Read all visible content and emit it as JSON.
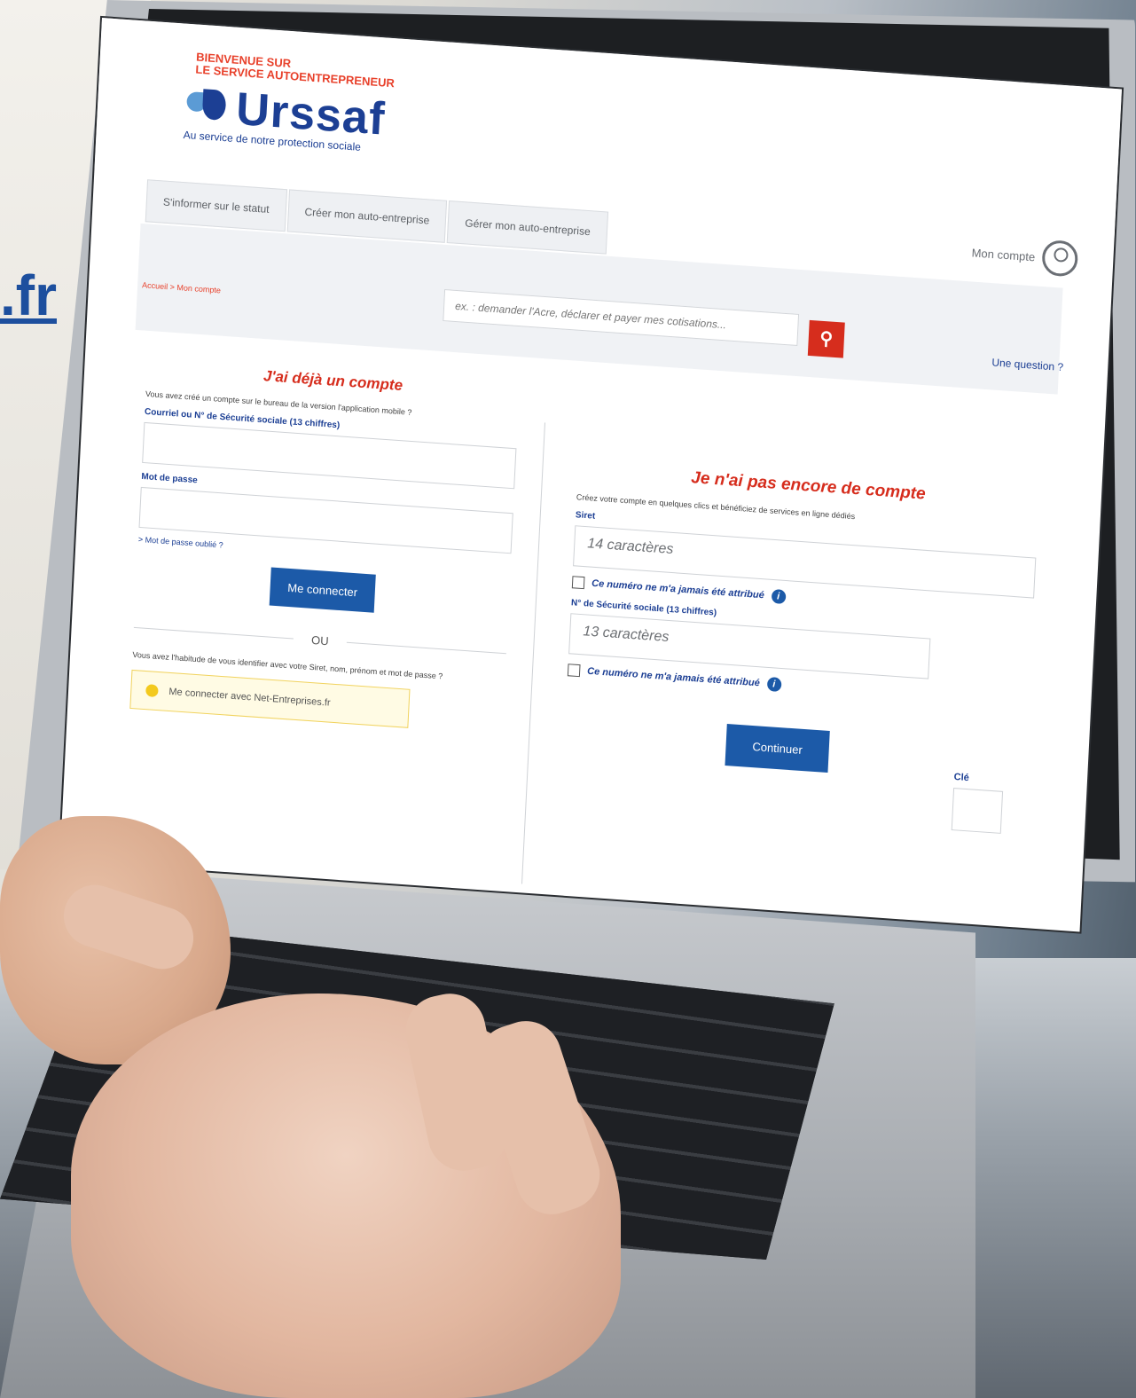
{
  "background": {
    "url_fragment": ".fr"
  },
  "header": {
    "welcome_line1": "BIENVENUE SUR",
    "welcome_line2": "LE SERVICE AUTOENTREPRENEUR",
    "logo_text": "Urssaf",
    "logo_tagline": "Au service de notre protection sociale",
    "account_label": "Mon compte"
  },
  "nav": {
    "tabs": [
      {
        "label": "S'informer sur le statut"
      },
      {
        "label": "Créer mon auto-entreprise"
      },
      {
        "label": "Gérer mon auto-entreprise"
      }
    ],
    "breadcrumb": "Accueil > Mon compte",
    "search_placeholder": "ex. : demander l'Acre, déclarer et payer mes cotisations...",
    "question_label": "Une question"
  },
  "login": {
    "title": "J'ai déjà un compte",
    "intro": "Vous avez créé un compte sur le bureau de la version l'application mobile ?",
    "id_label": "Courriel ou N° de Sécurité sociale (13 chiffres)",
    "password_label": "Mot de passe",
    "forgot_label": "> Mot de passe oublié ?",
    "connect_button": "Me connecter",
    "or_label": "OU",
    "netentreprises_intro": "Vous avez l'habitude de vous identifier avec votre Siret, nom, prénom et mot de passe ?",
    "netentreprises_button": "Me connecter avec Net-Entreprises.fr"
  },
  "register": {
    "title": "Je n'ai pas encore de compte",
    "intro": "Créez votre compte en quelques clics et bénéficiez de services en ligne dédiés",
    "siret_label": "Siret",
    "siret_placeholder": "14 caractères",
    "siret_check": "Ce numéro ne m'a jamais été attribué",
    "ssn_label": "N° de Sécurité sociale (13 chiffres)",
    "ssn_placeholder": "13 caractères",
    "cle_label": "Clé",
    "ssn_check": "Ce numéro ne m'a jamais été attribué",
    "continue_button": "Continuer"
  },
  "colors": {
    "brand_blue": "#1c3f94",
    "accent_red": "#d62d1d",
    "button_blue": "#1c5aa8"
  },
  "icons": {
    "search": "magnifier-icon",
    "account": "user-circle-icon",
    "info": "info-icon",
    "question": "help-circle-icon"
  }
}
